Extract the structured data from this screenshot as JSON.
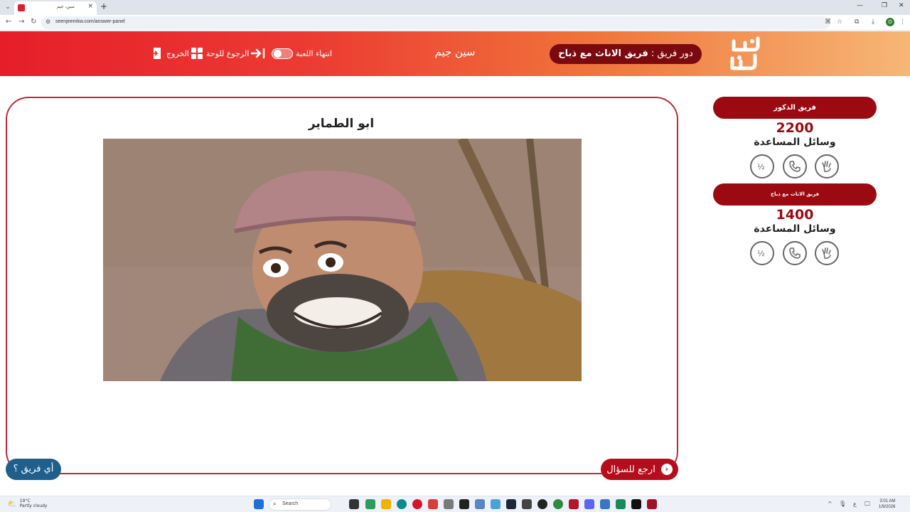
{
  "browser": {
    "tab_title": "سين، جيم",
    "url": "seenjeemkw.com/answer-panel",
    "new_tab": "+",
    "close_tab": "×"
  },
  "header": {
    "turn_prefix": "دور فريق :",
    "turn_team": "فريق الاناث مع ذباح",
    "app_name": "سين جيم",
    "end_game": "انتهاء اللعبة",
    "back_to_board": "الرجوع للوحة",
    "exit": "الخروج",
    "colors": {
      "start": "#e61e2a",
      "end": "#f6b777",
      "pill": "#7a0a0f"
    }
  },
  "question": {
    "answer": "ابو الطماير",
    "image_icon": "character-photo"
  },
  "buttons": {
    "back_to_question": "ارجع للسؤال",
    "which_team": "أي فريق ؟"
  },
  "teams": [
    {
      "name": "فريق الذكور",
      "score": "2200",
      "aids_label": "وسائل المساعدة",
      "aids": [
        "two-answers-icon",
        "call-friend-icon",
        "hand-icon"
      ]
    },
    {
      "name": "فريق الاناث مع ذباح",
      "score": "1400",
      "aids_label": "وسائل المساعدة",
      "aids": [
        "two-answers-icon",
        "call-friend-icon",
        "hand-icon"
      ]
    }
  ],
  "taskbar": {
    "temp": "19°C",
    "weather": "Partly cloudy",
    "search": "Search",
    "time": "3:01 AM",
    "date": "1/9/2026"
  }
}
